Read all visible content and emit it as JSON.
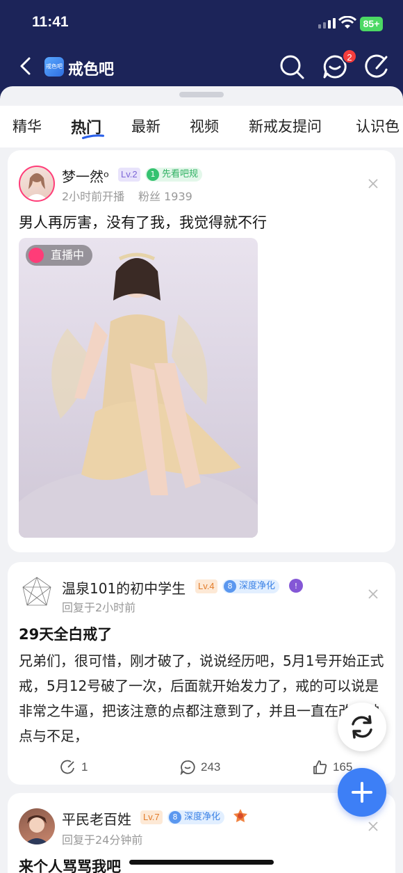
{
  "status_bar": {
    "time": "11:41",
    "battery": "85+"
  },
  "header": {
    "forum_name": "戒色吧",
    "logo_text": "戒色吧",
    "notification_count": "2"
  },
  "tabs": [
    {
      "label": "精华",
      "active": false
    },
    {
      "label": "热门",
      "active": true
    },
    {
      "label": "最新",
      "active": false
    },
    {
      "label": "视频",
      "active": false
    },
    {
      "label": "新戒友提问",
      "active": false
    },
    {
      "label": "认识色",
      "active": false
    }
  ],
  "posts": [
    {
      "username": "梦一然ᵒ",
      "level": "Lv.2",
      "tag_num": "1",
      "tag_label": "先看吧规",
      "meta_time": "2小时前开播",
      "meta_fans": "粉丝 1939",
      "title": "男人再厉害，没有了我，我觉得就不行",
      "live_label": "直播中"
    },
    {
      "username": "温泉101的初中学生",
      "level": "Lv.4",
      "tag_num": "8",
      "tag_label": "深度净化",
      "meta": "回复于2小时前",
      "title": "29天全白戒了",
      "body": "兄弟们，很可惜，刚才破了，说说经历吧，5月1号开始正式戒，5月12号破了一次，后面就开始发力了，戒的可以说是非常之牛逼，把该注意的点都注意到了，并且一直在改正缺点与不足，",
      "share_count": "1",
      "comment_count": "243",
      "like_count": "165"
    },
    {
      "username": "平民老百姓",
      "level": "Lv.7",
      "tag_num": "8",
      "tag_label": "深度净化",
      "meta": "回复于24分钟前",
      "title": "来个人骂骂我吧"
    }
  ],
  "colors": {
    "header_bg": "#1c2459",
    "accent_blue": "#3d7ff6",
    "badge_red": "#f43d3d"
  }
}
